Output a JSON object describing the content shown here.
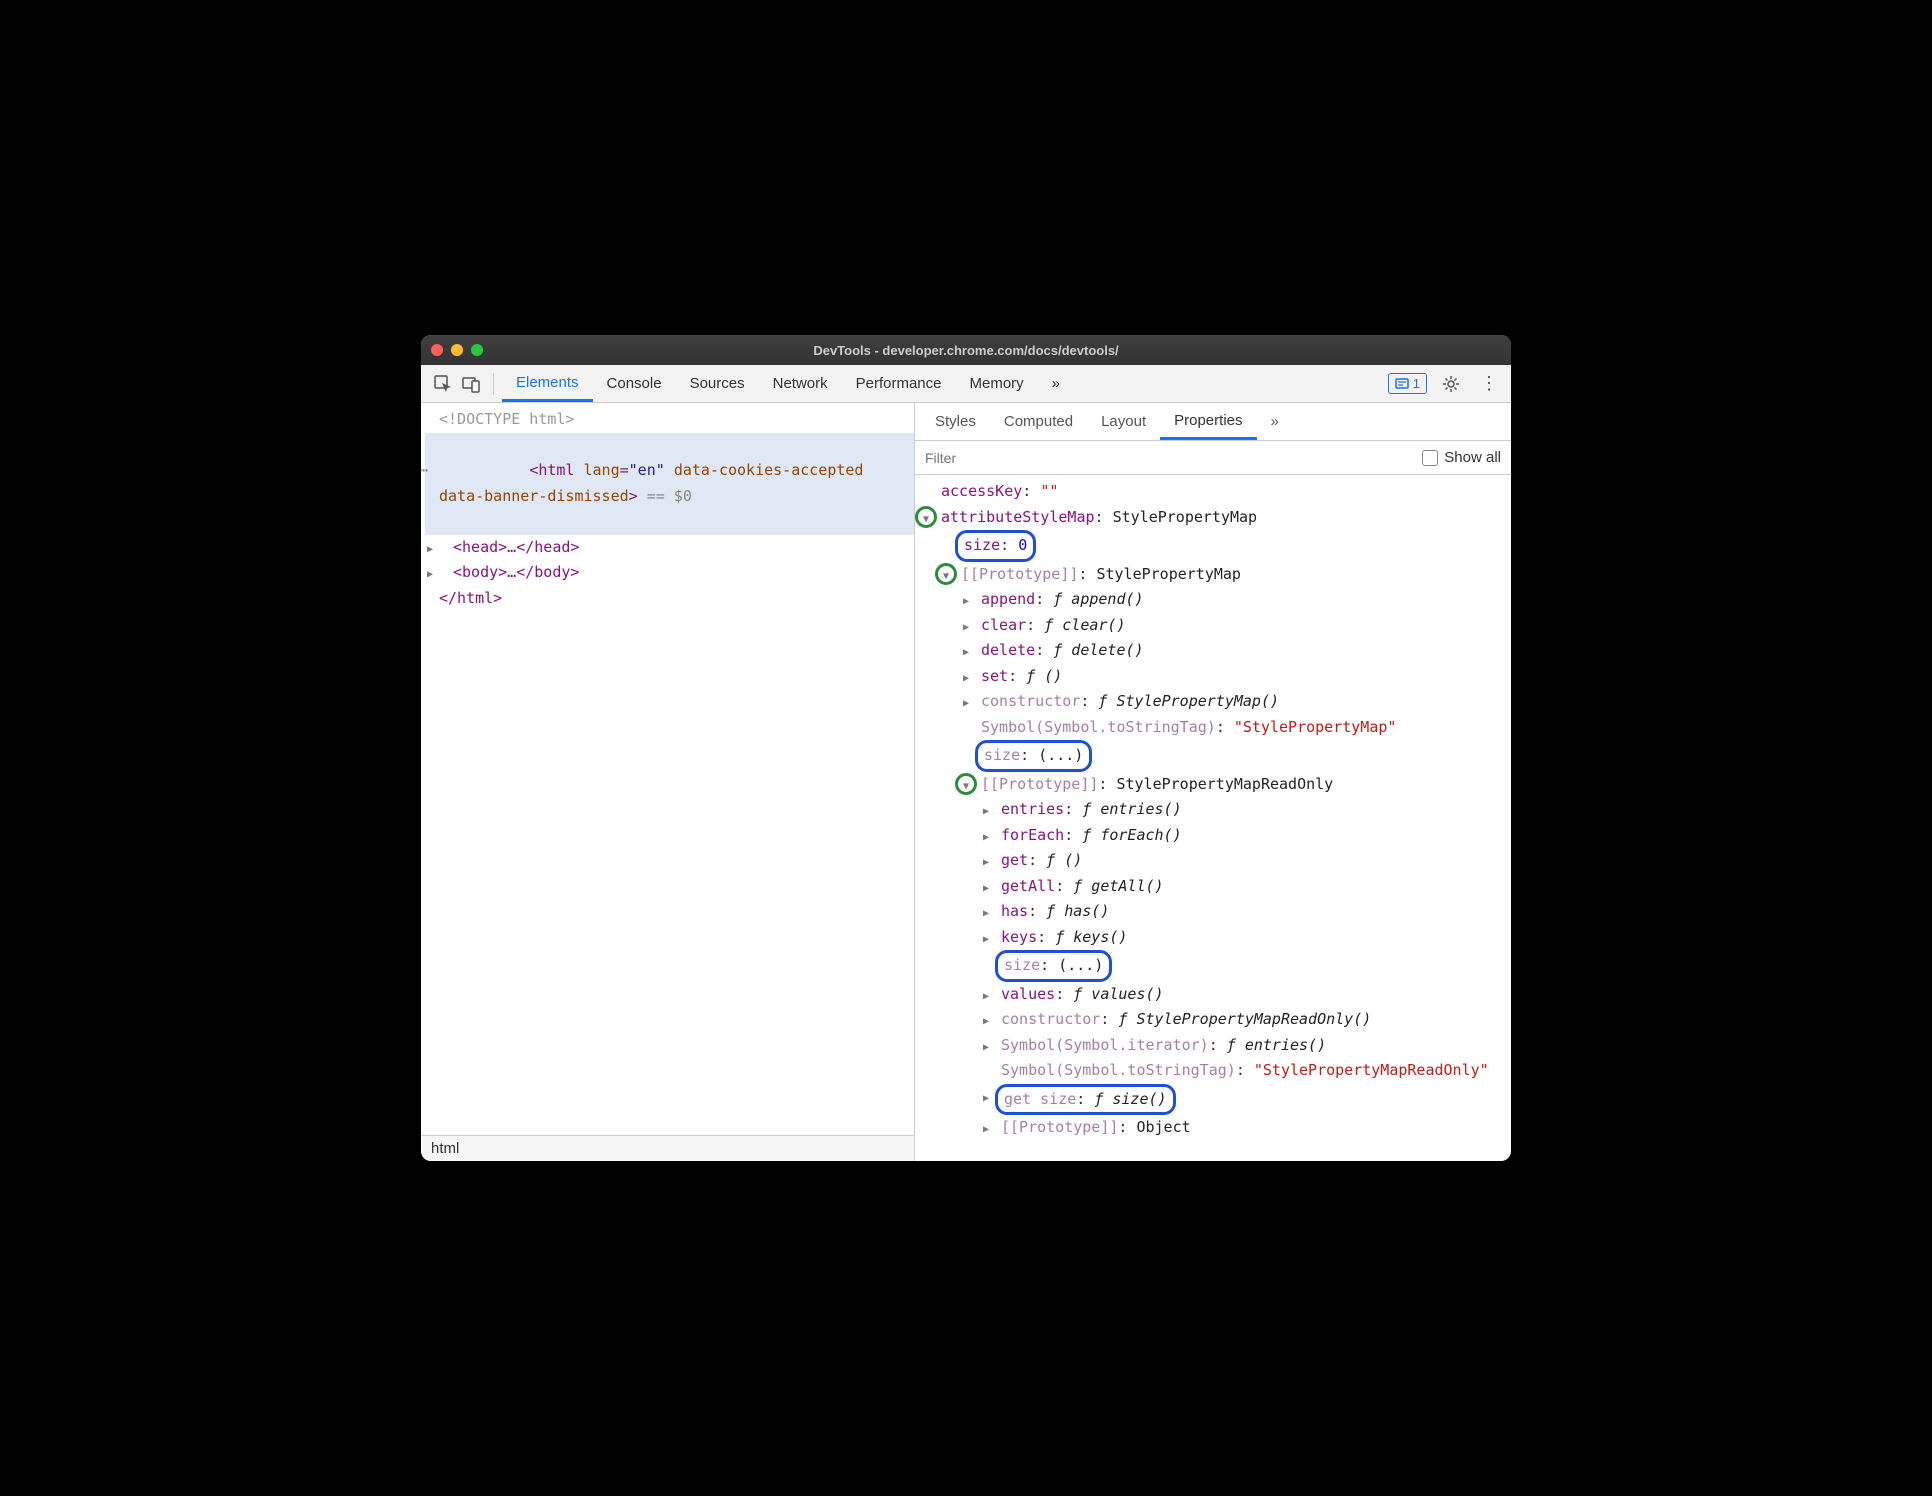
{
  "titlebar": {
    "title": "DevTools - developer.chrome.com/docs/devtools/"
  },
  "toolbar": {
    "tabs": [
      "Elements",
      "Console",
      "Sources",
      "Network",
      "Performance",
      "Memory"
    ],
    "active_tab": "Elements",
    "more": "»",
    "issues_count": "1"
  },
  "dom": {
    "doctype": "<!DOCTYPE html>",
    "html_open_pre": "<html ",
    "html_lang_attr": "lang",
    "html_lang_val": "\"en\"",
    "html_attr2": "data-cookies-accepted",
    "html_attr3": "data-banner-dismissed",
    "html_open_post": ">",
    "eqzero": " == $0",
    "head": "<head>…</head>",
    "body": "<body>…</body>",
    "html_close": "</html>",
    "crumb": "html"
  },
  "right": {
    "subtabs": [
      "Styles",
      "Computed",
      "Layout",
      "Properties"
    ],
    "active_subtab": "Properties",
    "more": "»",
    "filter_placeholder": "Filter",
    "show_all_label": "Show all"
  },
  "props": {
    "r0": {
      "k": "accessKey",
      "v": "\"\""
    },
    "r1": {
      "k": "attributeStyleMap",
      "v": "StylePropertyMap"
    },
    "r2": {
      "k": "size",
      "v": "0"
    },
    "r3": {
      "k": "[[Prototype]]",
      "v": "StylePropertyMap"
    },
    "r4": {
      "k": "append",
      "v": "ƒ append()"
    },
    "r5": {
      "k": "clear",
      "v": "ƒ clear()"
    },
    "r6": {
      "k": "delete",
      "v": "ƒ delete()"
    },
    "r7": {
      "k": "set",
      "v": "ƒ ()"
    },
    "r8": {
      "k": "constructor",
      "v": "ƒ StylePropertyMap()"
    },
    "r9": {
      "k": "Symbol(Symbol.toStringTag)",
      "v": "\"StylePropertyMap\""
    },
    "r10": {
      "k": "size",
      "v": "(...)"
    },
    "r11": {
      "k": "[[Prototype]]",
      "v": "StylePropertyMapReadOnly"
    },
    "r12": {
      "k": "entries",
      "v": "ƒ entries()"
    },
    "r13": {
      "k": "forEach",
      "v": "ƒ forEach()"
    },
    "r14": {
      "k": "get",
      "v": "ƒ ()"
    },
    "r15": {
      "k": "getAll",
      "v": "ƒ getAll()"
    },
    "r16": {
      "k": "has",
      "v": "ƒ has()"
    },
    "r17": {
      "k": "keys",
      "v": "ƒ keys()"
    },
    "r18": {
      "k": "size",
      "v": "(...)"
    },
    "r19": {
      "k": "values",
      "v": "ƒ values()"
    },
    "r20": {
      "k": "constructor",
      "v": "ƒ StylePropertyMapReadOnly()"
    },
    "r21": {
      "k": "Symbol(Symbol.iterator)",
      "v": "ƒ entries()"
    },
    "r22": {
      "k": "Symbol(Symbol.toStringTag)",
      "v": "\"StylePropertyMapReadOnly\""
    },
    "r23": {
      "k": "get size",
      "v": "ƒ size()"
    },
    "r24": {
      "k": "[[Prototype]]",
      "v": "Object"
    }
  }
}
